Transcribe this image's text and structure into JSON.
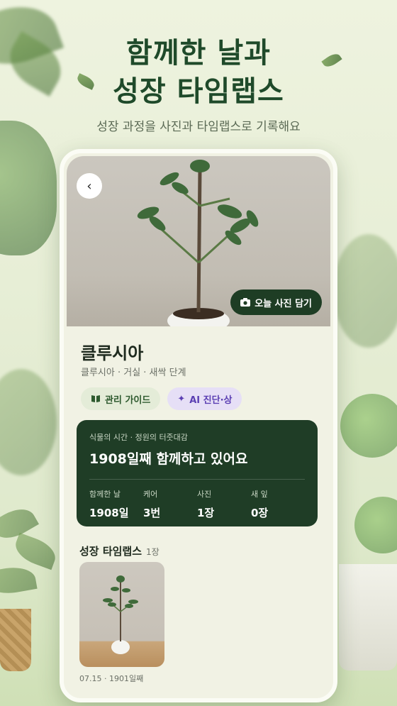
{
  "hero": {
    "title_line1": "함께한 날과",
    "title_line2": "성장 타임랩스",
    "subtitle": "성장 과정을 사진과 타임랩스로 기록해요"
  },
  "photo": {
    "back_icon": "chevron-left-icon",
    "capture_label": "오늘 사진 담기",
    "capture_icon": "camera-icon"
  },
  "plant": {
    "name": "클루시아",
    "meta": "클루시아 · 거실 · 새싹 단계"
  },
  "chips": {
    "guide_label": "관리 가이드",
    "guide_icon": "book-icon",
    "ai_label": "AI 진단·상",
    "ai_icon": "sparkle-icon"
  },
  "stats_card": {
    "caption": "식물의 시간 · 정원의 터줏대감",
    "title": "1908일째 함께하고 있어요",
    "stats": [
      {
        "label": "함께한 날",
        "value": "1908일"
      },
      {
        "label": "케어",
        "value": "3번"
      },
      {
        "label": "사진",
        "value": "1장"
      },
      {
        "label": "새 잎",
        "value": "0장"
      }
    ]
  },
  "timelapse": {
    "title": "성장 타임랩스",
    "count": "1장",
    "items": [
      {
        "caption": "07.15 · 1901일째"
      }
    ]
  },
  "colors": {
    "accent_dark_green": "#1f3d26",
    "title_green": "#1f4a2a",
    "ai_purple": "#5b3fb3"
  }
}
